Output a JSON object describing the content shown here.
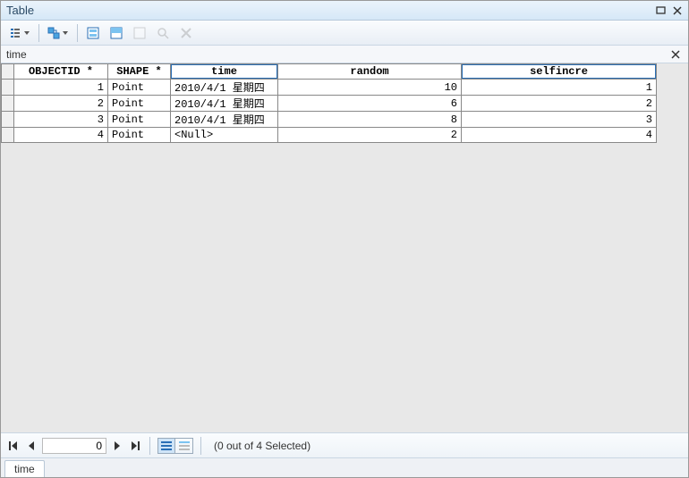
{
  "window": {
    "title": "Table"
  },
  "subtitle": {
    "text": "time"
  },
  "columns": [
    {
      "key": "OBJECTID",
      "label": "OBJECTID *"
    },
    {
      "key": "SHAPE",
      "label": "SHAPE *"
    },
    {
      "key": "time",
      "label": "time",
      "selected": true
    },
    {
      "key": "random",
      "label": "random"
    },
    {
      "key": "selfincre",
      "label": "selfincre"
    }
  ],
  "rows": [
    {
      "OBJECTID": "1",
      "SHAPE": "Point",
      "time": "2010/4/1 星期四",
      "random": "10",
      "selfincre": "1"
    },
    {
      "OBJECTID": "2",
      "SHAPE": "Point",
      "time": "2010/4/1 星期四",
      "random": "6",
      "selfincre": "2"
    },
    {
      "OBJECTID": "3",
      "SHAPE": "Point",
      "time": "2010/4/1 星期四",
      "random": "8",
      "selfincre": "3"
    },
    {
      "OBJECTID": "4",
      "SHAPE": "Point",
      "time": "<Null>",
      "random": "2",
      "selfincre": "4"
    }
  ],
  "nav": {
    "current": "0",
    "status": "(0 out of 4 Selected)"
  },
  "tab": {
    "label": "time"
  }
}
